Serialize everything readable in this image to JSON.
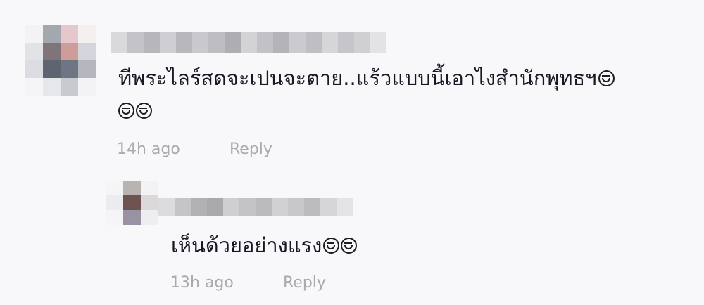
{
  "comments": [
    {
      "text": "ทีพระไลร์สดจะเปนจะตาย..แร้วแบบนี้เอาไงสํานักพุทธฯ",
      "emoji_icon": "grinning-sweat-emoji",
      "emoji_count_inline": 1,
      "emoji_count_wrapped": 2,
      "time": "14h ago",
      "reply_label": "Reply",
      "replies": [
        {
          "text": "เห็นด้วยอย่างแรง",
          "emoji_icon": "grinning-sweat-emoji",
          "emoji_count": 2,
          "time": "13h ago",
          "reply_label": "Reply"
        }
      ]
    }
  ],
  "colors": {
    "background": "#f8f8fa",
    "text": "#161823",
    "meta_text": "#a9aab0"
  }
}
